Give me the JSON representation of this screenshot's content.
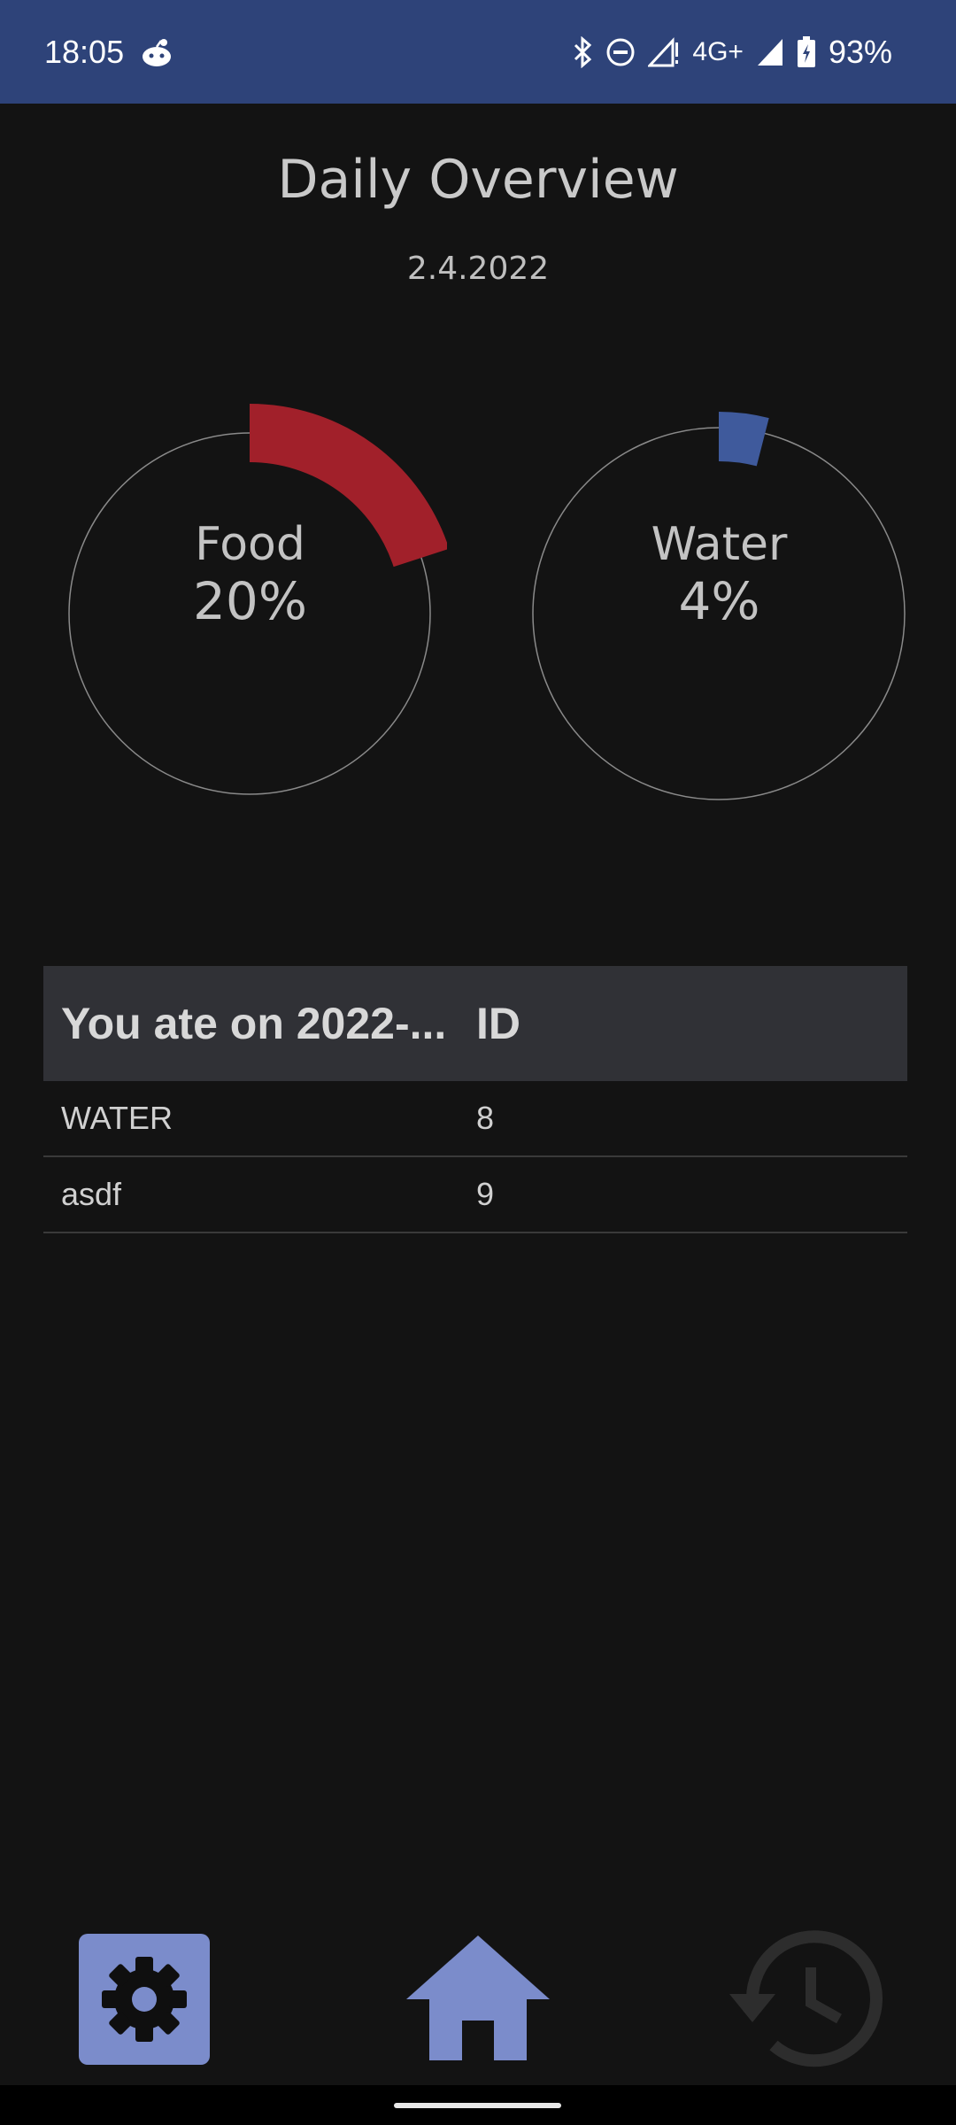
{
  "status": {
    "time": "18:05",
    "network": "4G+",
    "battery": "93%"
  },
  "header": {
    "title": "Daily Overview",
    "date": "2.4.2022"
  },
  "gauges": {
    "food": {
      "label": "Food",
      "value": "20%",
      "fraction": 0.2,
      "color": "#a1202a"
    },
    "water": {
      "label": "Water",
      "value": "4%",
      "fraction": 0.04,
      "color": "#3f5a9c"
    }
  },
  "table": {
    "columns": [
      "You ate on 2022-...",
      "ID"
    ],
    "rows": [
      {
        "name": "WATER",
        "id": "8"
      },
      {
        "name": "asdf",
        "id": "9"
      }
    ]
  },
  "nav": {
    "items": [
      {
        "icon": "gear-icon",
        "label": "settings"
      },
      {
        "icon": "home-icon",
        "label": "home"
      },
      {
        "icon": "history-icon",
        "label": "history"
      }
    ],
    "accent": "#7b8ccb"
  }
}
